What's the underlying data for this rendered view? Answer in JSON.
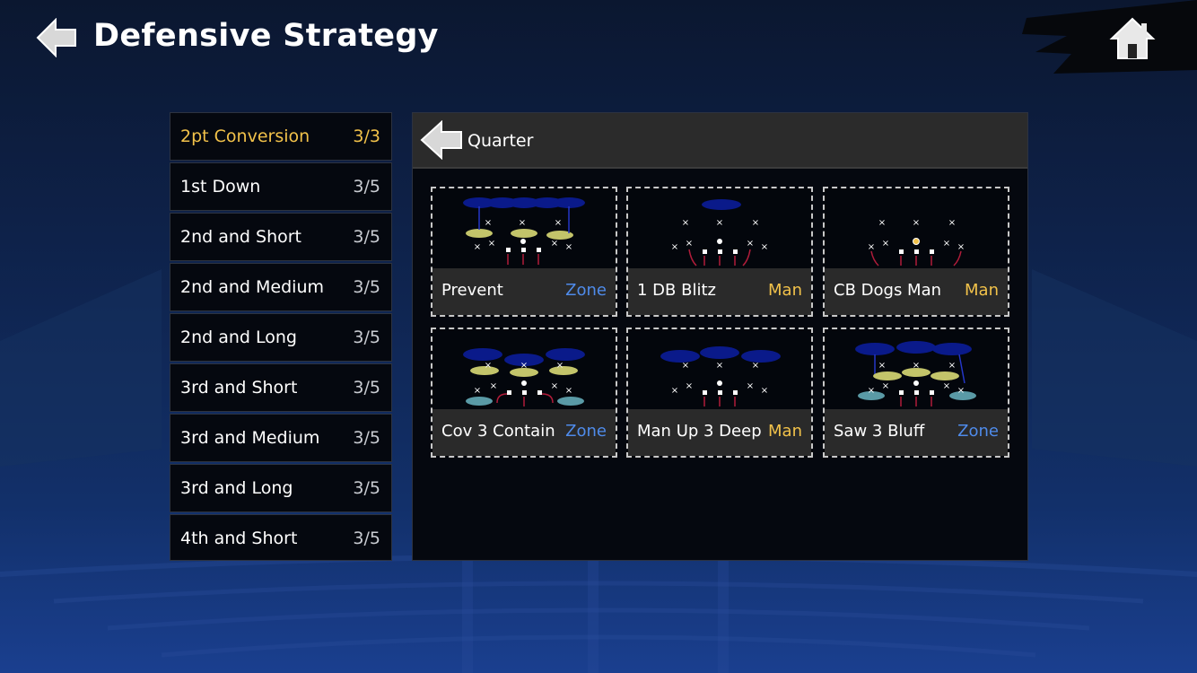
{
  "header": {
    "title": "Defensive Strategy",
    "back_icon": "back-arrow-icon",
    "home_icon": "home-icon"
  },
  "colors": {
    "active": "#f2c24a",
    "zone": "#4f8bea",
    "man": "#f2c24a",
    "panel_bg": "#05080f"
  },
  "sidebar": {
    "items": [
      {
        "label": "2pt Conversion",
        "count": "3/3",
        "active": true
      },
      {
        "label": "1st Down",
        "count": "3/5"
      },
      {
        "label": "2nd and Short",
        "count": "3/5"
      },
      {
        "label": "2nd and Medium",
        "count": "3/5"
      },
      {
        "label": "2nd and Long",
        "count": "3/5"
      },
      {
        "label": "3rd and Short",
        "count": "3/5"
      },
      {
        "label": "3rd and Medium",
        "count": "3/5"
      },
      {
        "label": "3rd and Long",
        "count": "3/5"
      },
      {
        "label": "4th and Short",
        "count": "3/5"
      }
    ]
  },
  "panel": {
    "back_label": "Quarter",
    "plays": [
      {
        "name": "Prevent",
        "type": "Zone"
      },
      {
        "name": "1 DB Blitz",
        "type": "Man"
      },
      {
        "name": "CB Dogs Man",
        "type": "Man"
      },
      {
        "name": "Cov 3 Contain",
        "type": "Zone"
      },
      {
        "name": "Man Up 3 Deep",
        "type": "Man"
      },
      {
        "name": "Saw 3 Bluff",
        "type": "Zone"
      }
    ]
  }
}
